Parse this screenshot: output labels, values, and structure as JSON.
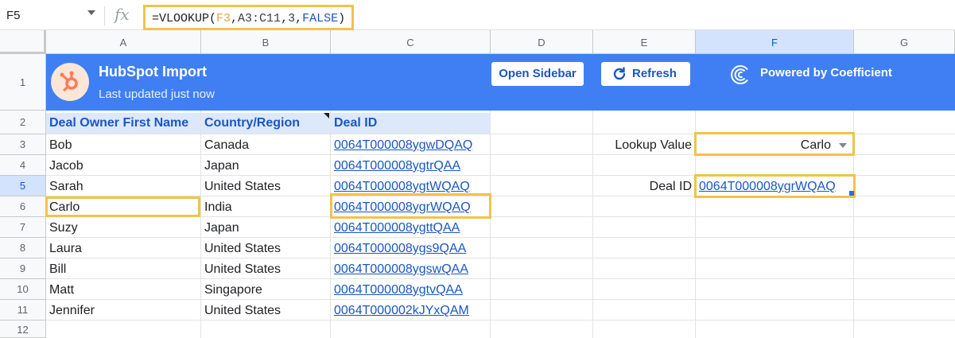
{
  "formula_bar": {
    "cell_ref": "F5",
    "fx": "fx",
    "formula_parts": [
      "=VLOOKUP(",
      "F3",
      ",",
      "A3:C11",
      ",",
      "3",
      ",",
      "FALSE",
      ")"
    ]
  },
  "columns": [
    "A",
    "B",
    "C",
    "D",
    "E",
    "F",
    "G"
  ],
  "rows": [
    "1",
    "2",
    "3",
    "4",
    "5",
    "6",
    "7",
    "8",
    "9",
    "10",
    "11",
    "12"
  ],
  "banner": {
    "title": "HubSpot Import",
    "subtitle": "Last updated just now",
    "open_sidebar": "Open Sidebar",
    "refresh": "Refresh",
    "powered_by": "Powered by Coefficient"
  },
  "table": {
    "headers": [
      "Deal Owner First Name",
      "Country/Region",
      "Deal ID"
    ],
    "rows": [
      [
        "Bob",
        "Canada",
        "0064T000008ygwDQAQ"
      ],
      [
        "Jacob",
        "Japan",
        "0064T000008ygtrQAA"
      ],
      [
        "Sarah",
        "United States",
        "0064T000008ygtWQAQ"
      ],
      [
        "Carlo",
        "India",
        "0064T000008ygrWQAQ"
      ],
      [
        "Suzy",
        "Japan",
        "0064T000008ygttQAA"
      ],
      [
        "Laura",
        "United States",
        "0064T000008ygs9QAA"
      ],
      [
        "Bill",
        "United States",
        "0064T000008ygswQAA"
      ],
      [
        "Matt",
        "Singapore",
        "0064T000008ygtvQAA"
      ],
      [
        "Jennifer",
        "United States",
        "0064T000002kJYxQAM"
      ]
    ]
  },
  "lookup": {
    "label": "Lookup Value",
    "value": "Carlo",
    "result_label": "Deal ID",
    "result_value": "0064T000008ygrWQAQ"
  },
  "colors": {
    "banner": "#3f7ff3",
    "highlight": "#f0c34a",
    "link": "#1a56c4",
    "header_fill": "#dde9fb"
  }
}
